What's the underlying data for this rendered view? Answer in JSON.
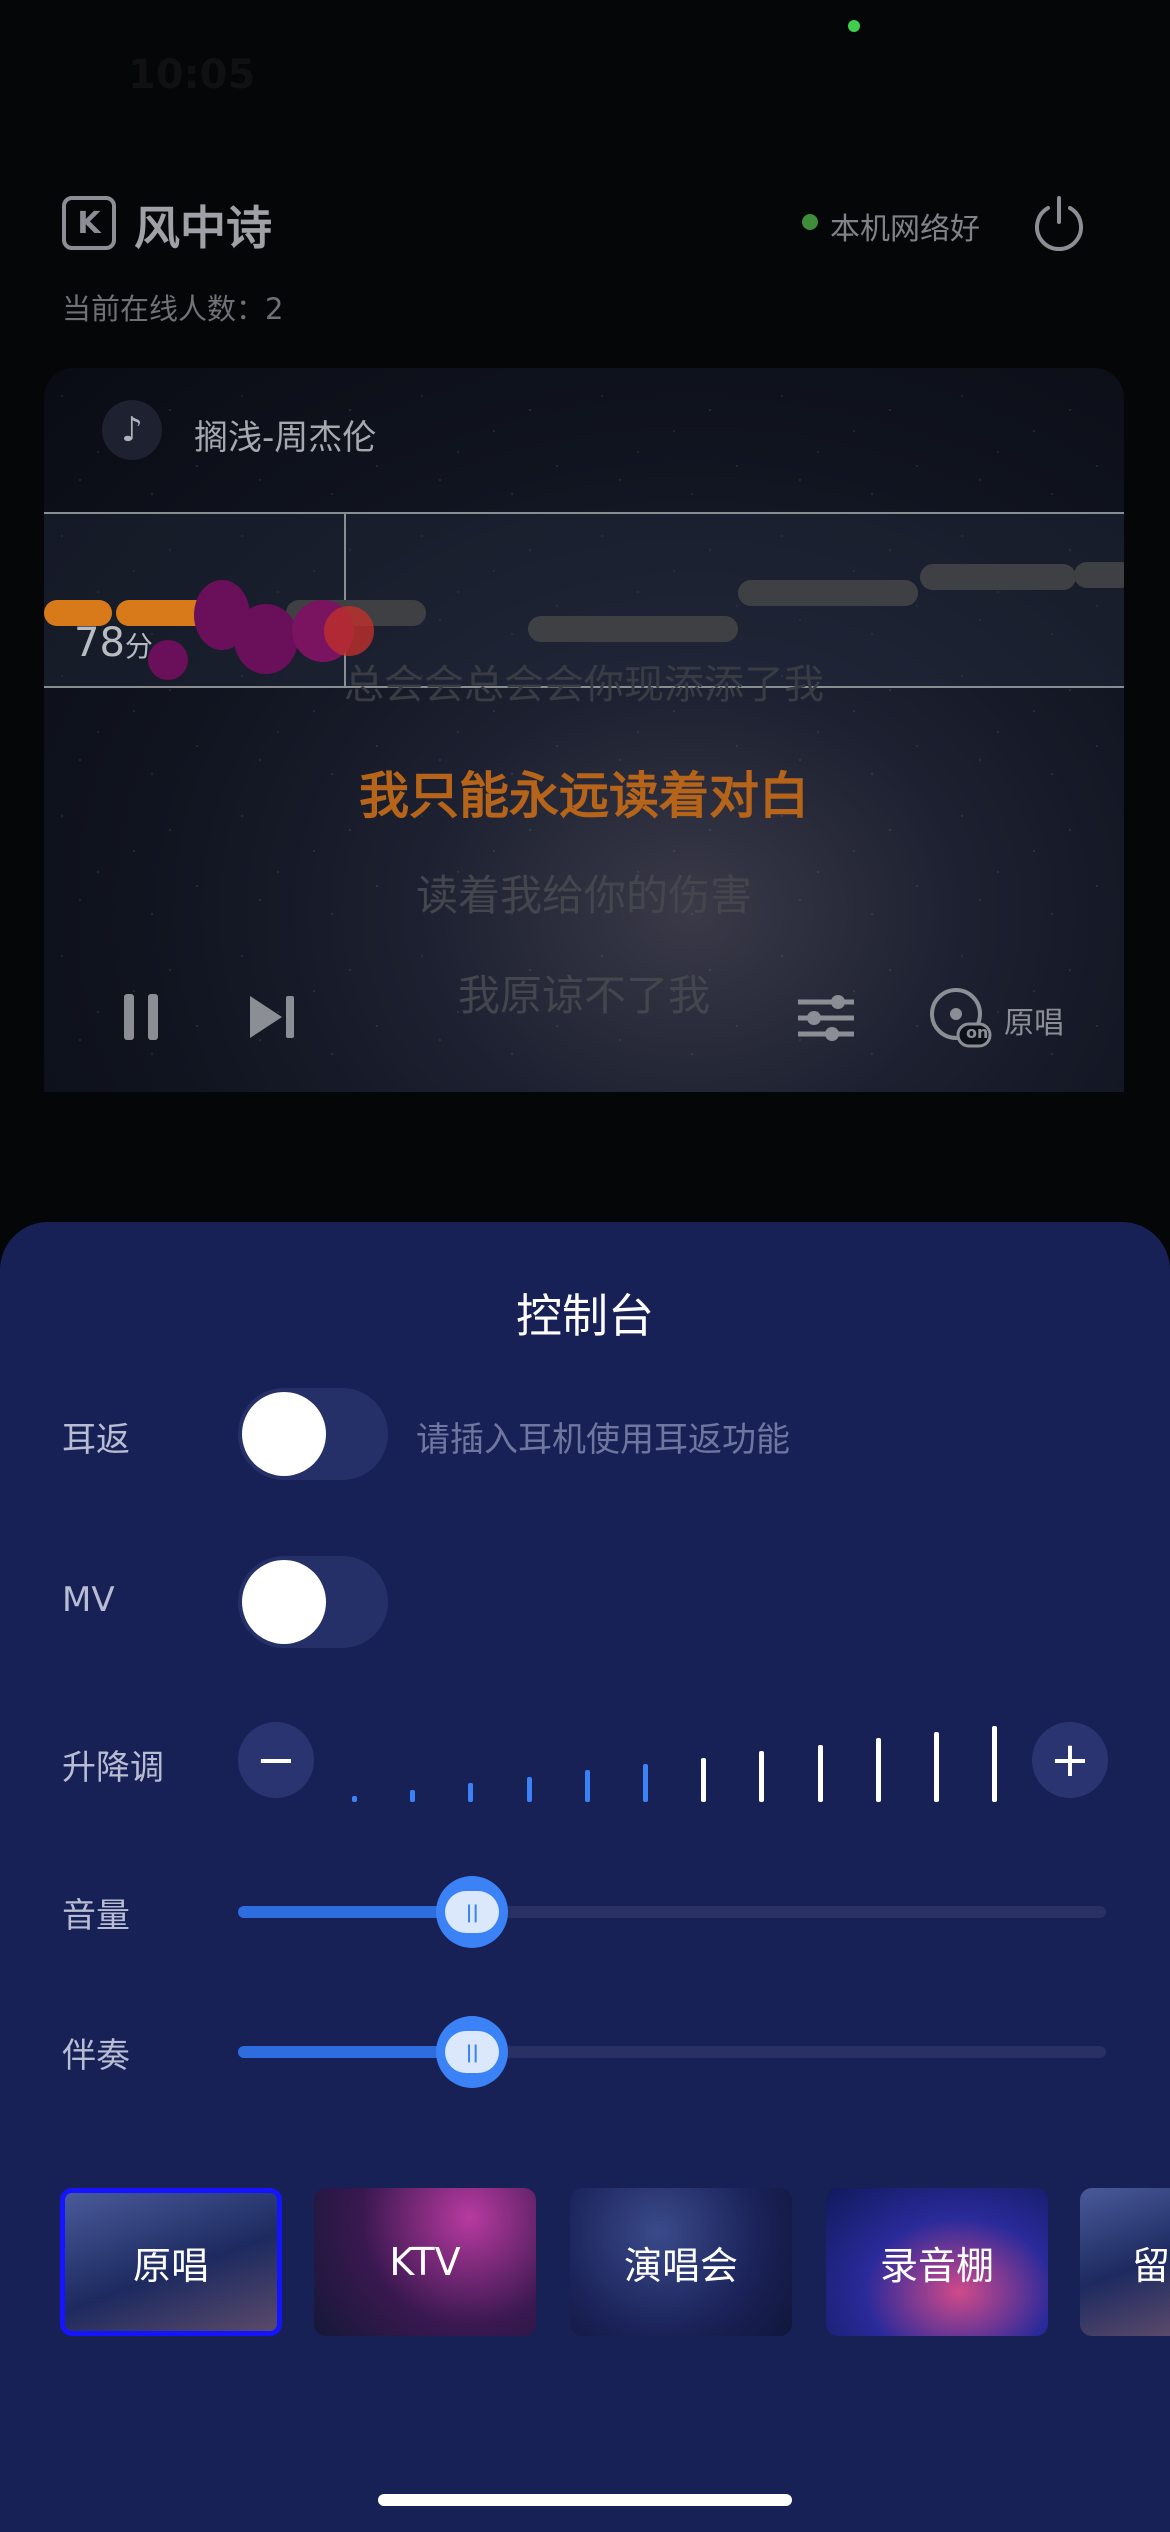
{
  "status_bar": {
    "time": "10:05"
  },
  "header": {
    "room_title": "风中诗",
    "logo_letter": "K",
    "online_label": "当前在线人数：2",
    "network_status": "本机网络好",
    "network_color": "#3f8c3a"
  },
  "player": {
    "song_title": "搁浅-周杰伦",
    "score_value": "78",
    "score_unit": "分",
    "lyrics": [
      "总会会总会会你现添添了我",
      "我只能永远读着对白",
      "读着我给你的伤害",
      "我原谅不了我"
    ],
    "original_label": "原唱",
    "original_badge": "on"
  },
  "console": {
    "title": "控制台",
    "ear_return": {
      "label": "耳返",
      "hint": "请插入耳机使用耳返功能",
      "on": false
    },
    "mv": {
      "label": "MV",
      "on": false
    },
    "pitch": {
      "label": "升降调",
      "minus": "−",
      "plus": "+",
      "level": 0
    },
    "volume": {
      "label": "音量",
      "value": 0.27
    },
    "accompaniment": {
      "label": "伴奏",
      "value": 0.27
    },
    "modes": [
      {
        "label": "原唱",
        "selected": true
      },
      {
        "label": "KTV",
        "selected": false
      },
      {
        "label": "演唱会",
        "selected": false
      },
      {
        "label": "录音棚",
        "selected": false
      },
      {
        "label": "留",
        "selected": false
      }
    ]
  },
  "colors": {
    "sheet_bg": "#182155",
    "accent": "#3b82f6",
    "selected_border": "#1414ff"
  }
}
